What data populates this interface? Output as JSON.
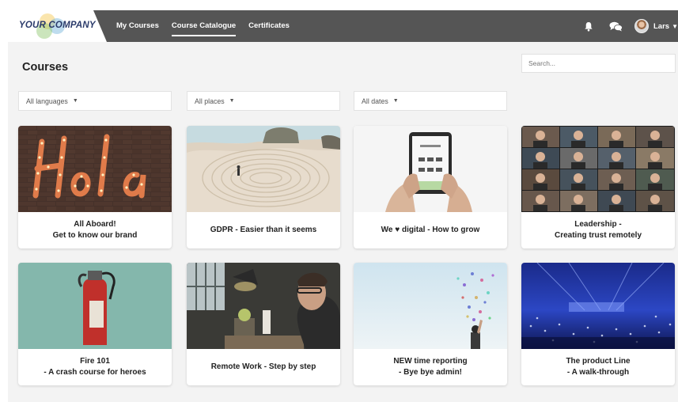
{
  "brand": {
    "name": "YOUR COMPANY"
  },
  "nav": {
    "links": [
      {
        "label": "My Courses",
        "active": false
      },
      {
        "label": "Course Catalogue",
        "active": true
      },
      {
        "label": "Certificates",
        "active": false
      }
    ],
    "icons": [
      "bell-icon",
      "chat-icon"
    ],
    "user": {
      "name": "Lars"
    }
  },
  "page": {
    "title": "Courses"
  },
  "search": {
    "placeholder": "Search..."
  },
  "filters": [
    {
      "label": "All languages"
    },
    {
      "label": "All places"
    },
    {
      "label": "All dates"
    }
  ],
  "courses": [
    {
      "line1": "All Aboard!",
      "line2": "Get to know our brand",
      "image": "hola-sign"
    },
    {
      "line1": "GDPR - Easier than it seems",
      "line2": "",
      "image": "sand-labyrinth"
    },
    {
      "line1": "We ♥ digital - How to grow",
      "line2": "",
      "image": "tablet-hands"
    },
    {
      "line1": "Leadership -",
      "line2": "Creating trust remotely",
      "image": "video-call-grid"
    },
    {
      "line1": "Fire 101",
      "line2": "- A crash course for heroes",
      "image": "fire-extinguisher"
    },
    {
      "line1": "Remote Work - Step by step",
      "line2": "",
      "image": "man-at-laptop"
    },
    {
      "line1": "NEW time reporting",
      "line2": "- Bye bye admin!",
      "image": "confetti-sky"
    },
    {
      "line1": "The product Line",
      "line2": "- A walk-through",
      "image": "concert-arena"
    }
  ],
  "colors": {
    "topbar": "#555555",
    "panel": "#f3f3f3",
    "card": "#ffffff",
    "logo_text": "#2a3a6a"
  }
}
